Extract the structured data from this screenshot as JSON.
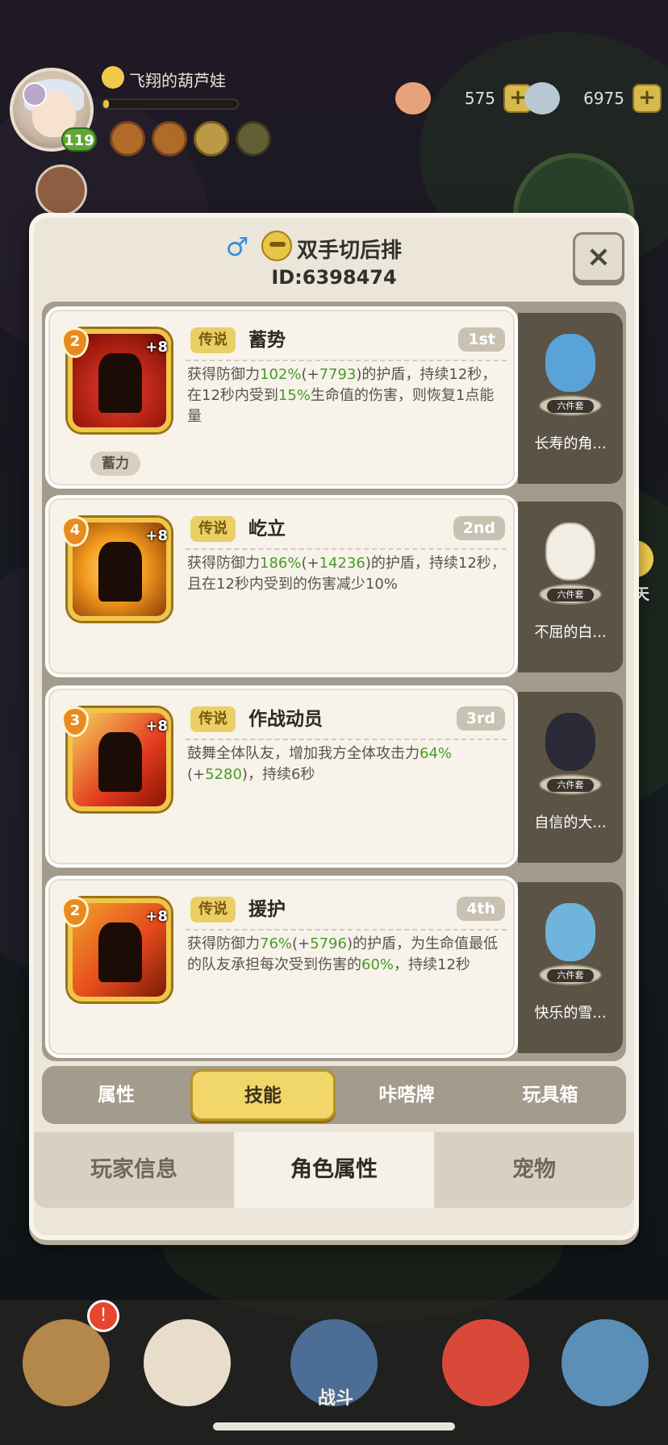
{
  "hud": {
    "player_name": "飞翔的葫芦娃",
    "level": "119",
    "xp_fill": 0.04,
    "currency_1": {
      "icon": "shell-fish-icon",
      "value": "575",
      "plus": "+"
    },
    "currency_2": {
      "icon": "pearl-shell-icon",
      "value": "6975",
      "plus": "+"
    }
  },
  "panel": {
    "character_name": "双手切后排",
    "character_id": "ID:6398474",
    "close_label": "×",
    "gender_icon": "♂"
  },
  "skills": [
    {
      "tag": "传说",
      "name": "蓄势",
      "rank": "1st",
      "level": "2",
      "bonus": "+8",
      "desc": [
        {
          "t": "获得防御力",
          "g": false
        },
        {
          "t": "102%",
          "g": true
        },
        {
          "t": "(+",
          "g": false
        },
        {
          "t": "7793",
          "g": true
        },
        {
          "t": ")的护盾，持续12秒，在12秒内受到",
          "g": false
        },
        {
          "t": "15%",
          "g": true
        },
        {
          "t": "生命值的伤害，则恢复1点能量",
          "g": false
        }
      ],
      "extra_tag": "蓄力",
      "figure_label": "长寿的角...",
      "set_label": "六件套"
    },
    {
      "tag": "传说",
      "name": "屹立",
      "rank": "2nd",
      "level": "4",
      "bonus": "+8",
      "desc": [
        {
          "t": "获得防御力",
          "g": false
        },
        {
          "t": "186%",
          "g": true
        },
        {
          "t": "(+",
          "g": false
        },
        {
          "t": "14236",
          "g": true
        },
        {
          "t": ")的护盾，持续12秒，且在12秒内受到的伤害减少10%",
          "g": false
        }
      ],
      "extra_tag": "",
      "figure_label": "不屈的白...",
      "set_label": "六件套"
    },
    {
      "tag": "传说",
      "name": "作战动员",
      "rank": "3rd",
      "level": "3",
      "bonus": "+8",
      "desc": [
        {
          "t": "鼓舞全体队友，增加我方全体攻击力",
          "g": false
        },
        {
          "t": "64%",
          "g": true
        },
        {
          "t": "(+",
          "g": false
        },
        {
          "t": "5280",
          "g": true
        },
        {
          "t": ")，持续6秒",
          "g": false
        }
      ],
      "extra_tag": "",
      "figure_label": "自信的大...",
      "set_label": "六件套"
    },
    {
      "tag": "传说",
      "name": "援护",
      "rank": "4th",
      "level": "2",
      "bonus": "+8",
      "desc": [
        {
          "t": "获得防御力",
          "g": false
        },
        {
          "t": "76%",
          "g": true
        },
        {
          "t": "(+",
          "g": false
        },
        {
          "t": "5796",
          "g": true
        },
        {
          "t": ")的护盾，为生命值最低的队友承担每次受到伤害的",
          "g": false
        },
        {
          "t": "60%",
          "g": true
        },
        {
          "t": "，持续12秒",
          "g": false
        }
      ],
      "extra_tag": "",
      "figure_label": "快乐的雪...",
      "set_label": "六件套"
    }
  ],
  "subtabs": [
    "属性",
    "技能",
    "咔嗒牌",
    "玩具箱"
  ],
  "subtab_active": 1,
  "bottom_tabs": [
    "玩家信息",
    "角色属性",
    "宠物"
  ],
  "bottom_tab_active": 1,
  "chat_label": "聊天",
  "nav": {
    "battle_label": "战斗",
    "notify_icon": "bell-icon"
  }
}
